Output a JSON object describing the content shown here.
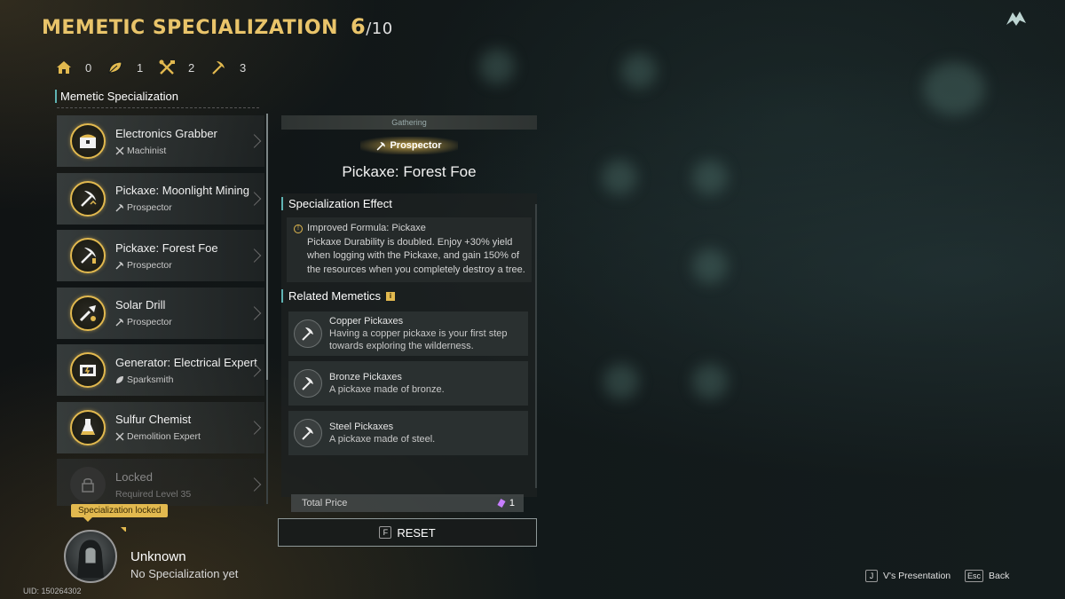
{
  "header": {
    "title": "MEMETIC SPECIALIZATION",
    "count": "6",
    "total": "/10"
  },
  "stats": [
    {
      "icon": "home-icon",
      "value": "0"
    },
    {
      "icon": "leaf-icon",
      "value": "1"
    },
    {
      "icon": "crossed-tools-icon",
      "value": "2"
    },
    {
      "icon": "pickaxe-icon",
      "value": "3"
    }
  ],
  "sidebar": {
    "heading": "Memetic Specialization",
    "items": [
      {
        "name": "Electronics Grabber",
        "role": "Machinist",
        "icon": "chest-icon"
      },
      {
        "name": "Pickaxe: Moonlight Mining",
        "role": "Prospector",
        "icon": "pickaxe-icon"
      },
      {
        "name": "Pickaxe: Forest Foe",
        "role": "Prospector",
        "icon": "pickaxe-icon"
      },
      {
        "name": "Solar Drill",
        "role": "Prospector",
        "icon": "drill-icon"
      },
      {
        "name": "Generator: Electrical Expert",
        "role": "Sparksmith",
        "icon": "generator-icon"
      },
      {
        "name": "Sulfur Chemist",
        "role": "Demolition Expert",
        "icon": "flask-icon"
      },
      {
        "name": "Locked",
        "role": "Required Level 35",
        "icon": "lock-icon"
      }
    ],
    "locked_pill": "Specialization locked"
  },
  "detail": {
    "category": "Gathering",
    "class": "Prospector",
    "title": "Pickaxe: Forest Foe",
    "effect_heading": "Specialization Effect",
    "effect_title": "Improved Formula: Pickaxe",
    "effect_desc": "Pickaxe Durability is doubled. Enjoy +30% yield when logging with the Pickaxe, and gain 150% of the resources when you completely destroy a tree.",
    "related_heading": "Related Memetics",
    "related": [
      {
        "name": "Copper Pickaxes",
        "desc": "Having a copper pickaxe is your first step towards exploring the wilderness."
      },
      {
        "name": "Bronze Pickaxes",
        "desc": "A pickaxe made of bronze."
      },
      {
        "name": "Steel Pickaxes",
        "desc": "A pickaxe made of steel."
      }
    ],
    "total_label": "Total Price",
    "total_value": "1",
    "reset_key": "F",
    "reset_label": "RESET"
  },
  "profile": {
    "name": "Unknown",
    "status": "No Specialization yet",
    "uid": "UID: 150264302"
  },
  "footer": {
    "presentation_key": "J",
    "presentation_label": "V's Presentation",
    "back_key": "Esc",
    "back_label": "Back"
  },
  "colors": {
    "accent_gold": "#e2b94f",
    "accent_teal": "#5fb3b3",
    "background": "#0c1112"
  }
}
